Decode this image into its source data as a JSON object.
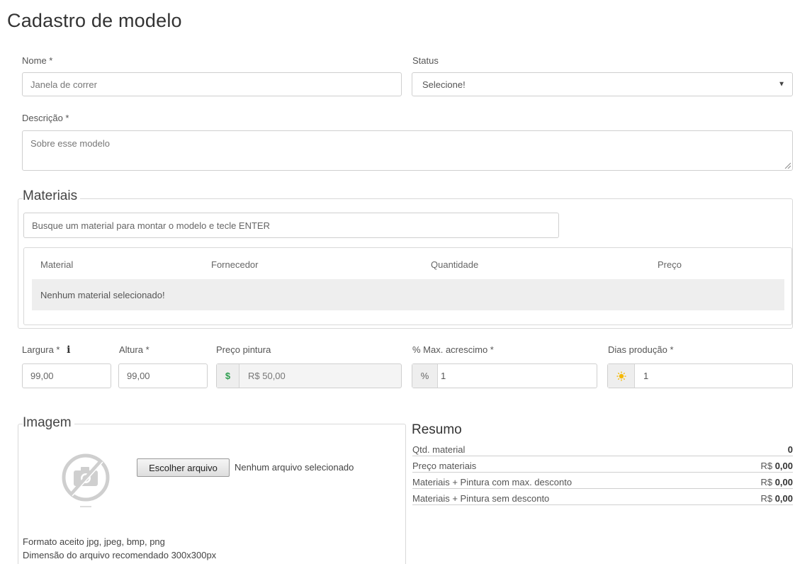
{
  "page": {
    "title": "Cadastro de modelo"
  },
  "form": {
    "nome": {
      "label": "Nome *",
      "value": "Janela de correr"
    },
    "status": {
      "label": "Status",
      "selected": "Selecione!"
    },
    "descricao": {
      "label": "Descrição *",
      "placeholder": "Sobre esse modelo"
    }
  },
  "materiais": {
    "legend": "Materiais",
    "search_placeholder": "Busque um material para montar o modelo e tecle ENTER",
    "columns": [
      "Material",
      "Fornecedor",
      "Quantidade",
      "Preço"
    ],
    "empty_message": "Nenhum material selecionado!"
  },
  "medidas": {
    "largura": {
      "label": "Largura *",
      "value": "99,00"
    },
    "altura": {
      "label": "Altura *",
      "value": "99,00"
    },
    "preco_pintura": {
      "label": "Preço pintura",
      "addon": "$",
      "value": "R$ 50,00"
    },
    "max_acrescimo": {
      "label": "% Max. acrescimo *",
      "addon": "%",
      "value": "1"
    },
    "dias_producao": {
      "label": "Dias produção *",
      "value": "1"
    }
  },
  "imagem": {
    "legend": "Imagem",
    "choose_button": "Escolher arquivo",
    "file_status": "Nenhum arquivo selecionado",
    "format_note": "Formato aceito jpg, jpeg, bmp, png",
    "dimension_note": "Dimensão do arquivo recomendado 300x300px"
  },
  "resumo": {
    "title": "Resumo",
    "rows": [
      {
        "label": "Qtd. material",
        "prefix": "",
        "value": "0"
      },
      {
        "label": "Preço materiais",
        "prefix": "R$ ",
        "value": "0,00"
      },
      {
        "label": "Materiais + Pintura com max. desconto",
        "prefix": "R$ ",
        "value": "0,00"
      },
      {
        "label": "Materiais + Pintura sem desconto",
        "prefix": "R$ ",
        "value": "0,00"
      }
    ]
  },
  "colors": {
    "dollar_addon": "#2e9e4f",
    "sun_icon": "#f5b800",
    "info_icon": "#333333"
  },
  "icons": [
    "info-icon",
    "dollar-icon",
    "percent-icon",
    "sun-icon",
    "camera-off-icon",
    "chevron-down-icon"
  ]
}
